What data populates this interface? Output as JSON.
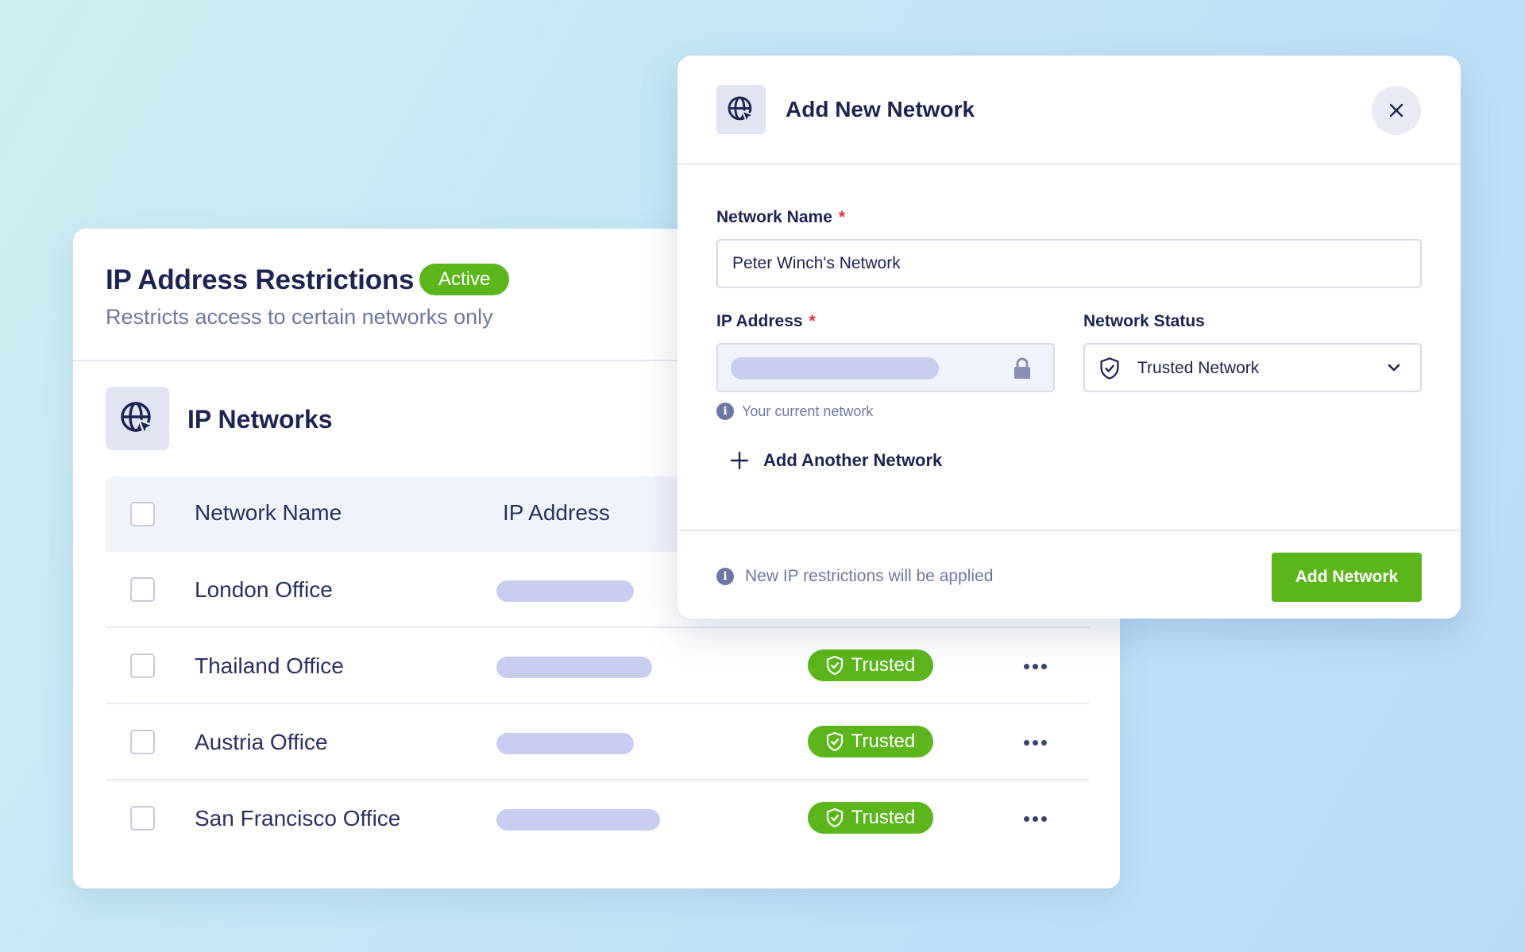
{
  "colors": {
    "accent_green": "#5cb51b",
    "navy_text": "#1d2452",
    "muted_text": "#6e77a3",
    "ip_placeholder": "#c8cdef"
  },
  "panel": {
    "title": "IP Address Restrictions",
    "status_badge": "Active",
    "subtitle": "Restricts access to certain networks only",
    "section_icon": "globe-cursor-icon",
    "section_title": "IP Networks",
    "table": {
      "columns": [
        "Network Name",
        "IP Address"
      ],
      "rows": [
        {
          "name": "London Office",
          "status": ""
        },
        {
          "name": "Thailand Office",
          "status": "Trusted"
        },
        {
          "name": "Austria Office",
          "status": "Trusted"
        },
        {
          "name": "San Francisco Office",
          "status": "Trusted"
        }
      ]
    }
  },
  "modal": {
    "icon": "globe-cursor-icon",
    "title": "Add New Network",
    "close_icon": "close-icon",
    "network_name": {
      "label": "Network Name",
      "required_mark": "*",
      "value": "Peter Winch's Network"
    },
    "ip_address": {
      "label": "IP Address",
      "required_mark": "*",
      "hint": "Your current network",
      "lock_icon": "lock-icon"
    },
    "network_status": {
      "label": "Network Status",
      "value": "Trusted Network"
    },
    "add_another_label": "Add Another Network",
    "footer_note": "New IP restrictions will be applied",
    "submit_label": "Add Network"
  }
}
